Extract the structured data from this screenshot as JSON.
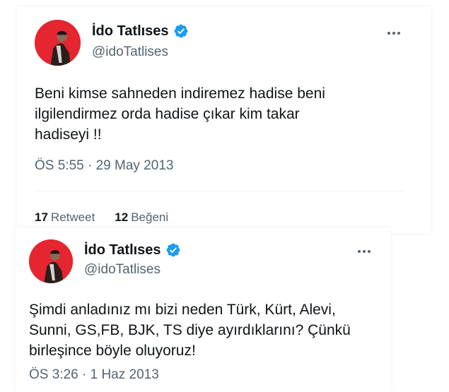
{
  "colors": {
    "verified": "#1d9bf0",
    "avatar_bg": "#e5252f",
    "text": "#0f1419",
    "secondary_text": "#536471"
  },
  "tweets": [
    {
      "display_name": "İdo Tatlıses",
      "handle": "@idoTatlises",
      "text": "Beni kimse sahneden indiremez hadise beni\nilgilendirmez orda hadise çıkar kim takar\nhadiseyi !!",
      "timestamp": "ÖS 5:55 · 29 May 2013",
      "retweet_count": "17",
      "retweet_label": "Retweet",
      "like_count": "12",
      "like_label": "Beğeni"
    },
    {
      "display_name": "İdo Tatlıses",
      "handle": "@idoTatlises",
      "text": "Şimdi anladınız mı bizi neden Türk, Kürt, Alevi,\nSunni, GS,FB, BJK, TS diye ayırdıklarını? Çünkü\nbirleşince böyle oluyoruz!",
      "timestamp": "ÖS 3:26 · 1 Haz 2013"
    }
  ]
}
